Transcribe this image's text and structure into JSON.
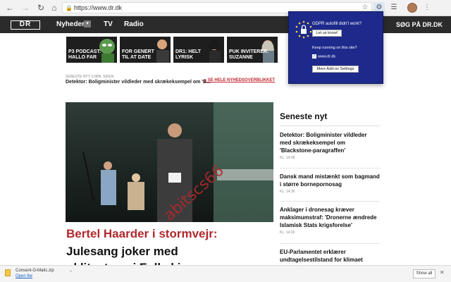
{
  "browser": {
    "url": "https://www.dr.dk",
    "back_icon": "arrow-left-icon",
    "forward_icon": "arrow-right-icon",
    "reload_icon": "reload-icon"
  },
  "site": {
    "logo_text": "DR",
    "menu": [
      "Nyheder",
      "TV",
      "Radio"
    ],
    "search_label": "SØG PÅ DR.DK"
  },
  "teasers": [
    {
      "label": "P3 PODCAST:\nHALLO FAR"
    },
    {
      "label": "FOR GENERT\nTIL AT DATE"
    },
    {
      "label": "DR1: HELT\nLYRISK"
    },
    {
      "label": "PUK INVITERER:\nSUZANNE"
    }
  ],
  "ticker": {
    "time": "SENESTE NYT: 6 MIN. SIDEN",
    "text": "Detektor: Boligminister vildleder med skrækeksempel om 'B...",
    "link": "SE HELE NYHEDSOVERBLIKKET"
  },
  "hero": {
    "kicker": "Bertel Haarder i stormvejr:",
    "line1": "Julesang joker med",
    "line2": "uklitset om i Folkeki..."
  },
  "watermark": "abitscs66",
  "latest": {
    "title": "Seneste nyt",
    "items": [
      {
        "headline": "Detektor: Boligminister vildleder med skrækeksempel om 'Blackstone-paragraffen'",
        "time": "KL. 14:28"
      },
      {
        "headline": "Dansk mand mistænkt som bagmand i større bornepornosag",
        "time": "KL. 14:26"
      },
      {
        "headline": "Anklager i dronesag kræver maksimumstraf: 'Dronerne ændrede Islamisk Stats krigsforelse'",
        "time": "KL. 14:20"
      },
      {
        "headline": "EU-Parlamentet erklærer undtagelsestilstand for klimaet",
        "time": ""
      }
    ]
  },
  "popup": {
    "question": "GDPR autofill didn't work?",
    "let_us_know": "Let us know!",
    "running_label": "Keep running on this site?",
    "site_label": "www.dr.dk",
    "settings_label": "More Add-on Settings"
  },
  "download": {
    "filename": "Consent-O-Matic.zip",
    "open_label": "Open file",
    "show_all": "Show all"
  }
}
